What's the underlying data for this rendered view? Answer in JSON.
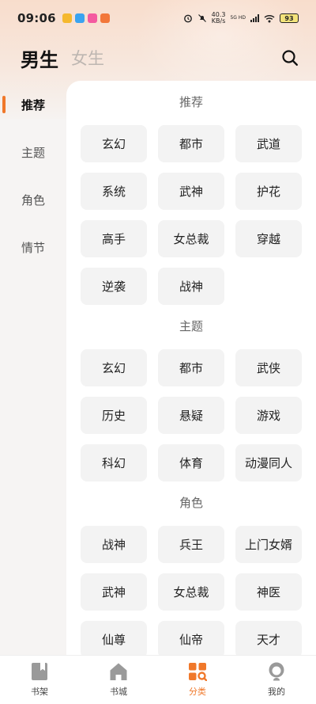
{
  "status": {
    "time": "09:06",
    "net_speed": "40.3",
    "net_unit": "KB/s",
    "signal": "5G HD",
    "battery": "93"
  },
  "header": {
    "tab_male": "男生",
    "tab_female": "女生"
  },
  "sidebar": {
    "items": [
      {
        "label": "推荐"
      },
      {
        "label": "主题"
      },
      {
        "label": "角色"
      },
      {
        "label": "情节"
      }
    ]
  },
  "sections": [
    {
      "title": "推荐",
      "tags": [
        "玄幻",
        "都市",
        "武道",
        "系统",
        "武神",
        "护花",
        "高手",
        "女总裁",
        "穿越",
        "逆袭",
        "战神"
      ]
    },
    {
      "title": "主题",
      "tags": [
        "玄幻",
        "都市",
        "武侠",
        "历史",
        "悬疑",
        "游戏",
        "科幻",
        "体育",
        "动漫同人"
      ]
    },
    {
      "title": "角色",
      "tags": [
        "战神",
        "兵王",
        "上门女婿",
        "武神",
        "女总裁",
        "神医",
        "仙尊",
        "仙帝",
        "天才"
      ]
    }
  ],
  "bottom_nav": {
    "items": [
      {
        "label": "书架",
        "icon": "bookmark-icon"
      },
      {
        "label": "书城",
        "icon": "home-icon"
      },
      {
        "label": "分类",
        "icon": "category-icon"
      },
      {
        "label": "我的",
        "icon": "profile-icon"
      }
    ]
  },
  "colors": {
    "accent": "#f0782a"
  }
}
